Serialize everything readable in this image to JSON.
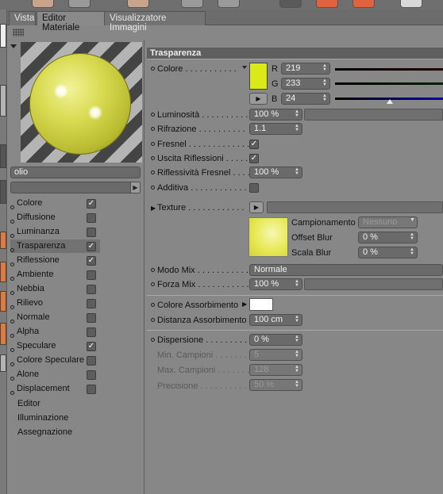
{
  "tabs": [
    "Vista",
    "Editor Materiale",
    "Visualizzatore Immagini"
  ],
  "material_name": "olio",
  "channels": [
    {
      "label": "Colore",
      "checked": true
    },
    {
      "label": "Diffusione",
      "checked": false
    },
    {
      "label": "Luminanza",
      "checked": false
    },
    {
      "label": "Trasparenza",
      "checked": true,
      "selected": true
    },
    {
      "label": "Riflessione",
      "checked": true
    },
    {
      "label": "Ambiente",
      "checked": false
    },
    {
      "label": "Nebbia",
      "checked": false
    },
    {
      "label": "Rilievo",
      "checked": false
    },
    {
      "label": "Normale",
      "checked": false
    },
    {
      "label": "Alpha",
      "checked": false
    },
    {
      "label": "Speculare",
      "checked": true
    },
    {
      "label": "Colore Speculare",
      "checked": false
    },
    {
      "label": "Alone",
      "checked": false
    },
    {
      "label": "Displacement",
      "checked": false
    }
  ],
  "extra_items": [
    "Editor",
    "Illuminazione",
    "Assegnazione"
  ],
  "section_title": "Trasparenza",
  "color": {
    "label": "Colore . . . . . . . . . . .",
    "swatch": "#dbe918",
    "r_label": "R",
    "r": "219",
    "g_label": "G",
    "g": "233",
    "b_label": "B",
    "b": "24"
  },
  "props": {
    "luminosita_label": "Luminosità . . . . . . . . . .",
    "luminosita": "100 %",
    "rifrazione_label": "Rifrazione . . . . . . . . . .",
    "rifrazione": "1.1",
    "fresnel_label": "Fresnel . . . . . . . . . . . . .",
    "uscita_label": "Uscita Riflessioni . . . . .",
    "riflessivita_label": "Riflessività Fresnel . . . . .",
    "riflessivita": "100 %",
    "additiva_label": "Additiva . . . . . . . . . . . . ."
  },
  "texture": {
    "label": "Texture . . . . . . . . . . . .",
    "campionamento_label": "Campionamento",
    "campionamento": "Nessuno",
    "offset_label": "Offset Blur",
    "offset": "0 %",
    "scala_label": "Scala Blur",
    "scala": "0 %"
  },
  "mix": {
    "modo_label": "Modo Mix . . . . . . . . . . .",
    "modo": "Normale",
    "forza_label": "Forza Mix . . . . . . . . . . .",
    "forza": "100 %"
  },
  "absorption": {
    "colore_label": "Colore Assorbimento",
    "colore_swatch": "#ffffff",
    "distanza_label": "Distanza Assorbimento",
    "distanza": "100 cm"
  },
  "dispersion": {
    "dispersione_label": "Dispersione . . . . . . . . .",
    "dispersione": "0 %",
    "min_label": "Min. Campioni . . . . . . . .",
    "min": "5",
    "max_label": "Max. Campioni . . . . . . .",
    "max": "128",
    "prec_label": "Precisione . . . . . . . . . .",
    "prec": "50 %"
  }
}
